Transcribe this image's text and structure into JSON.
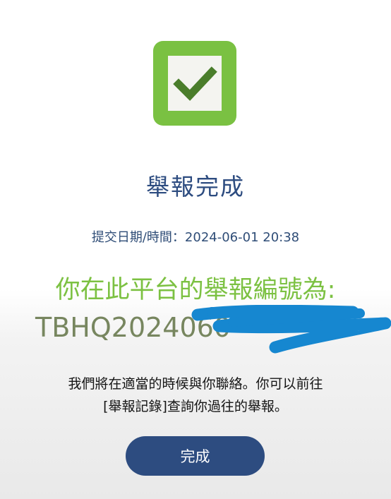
{
  "status_icon": "check-icon",
  "colors": {
    "accent_green": "#7ac142",
    "brand_blue": "#2d4c80",
    "redaction_blue": "#1687d0"
  },
  "title": "舉報完成",
  "datetime_text": "提交日期/時間：2024-06-01 20:38",
  "report_label": "你在此平台的舉報編號為:",
  "report_number": "TBHQ2024060",
  "message_line1": "我們將在適當的時候與你聯絡。你可以前往",
  "message_line2": "[舉報記錄]查詢你過往的舉報。",
  "done_label": "完成"
}
